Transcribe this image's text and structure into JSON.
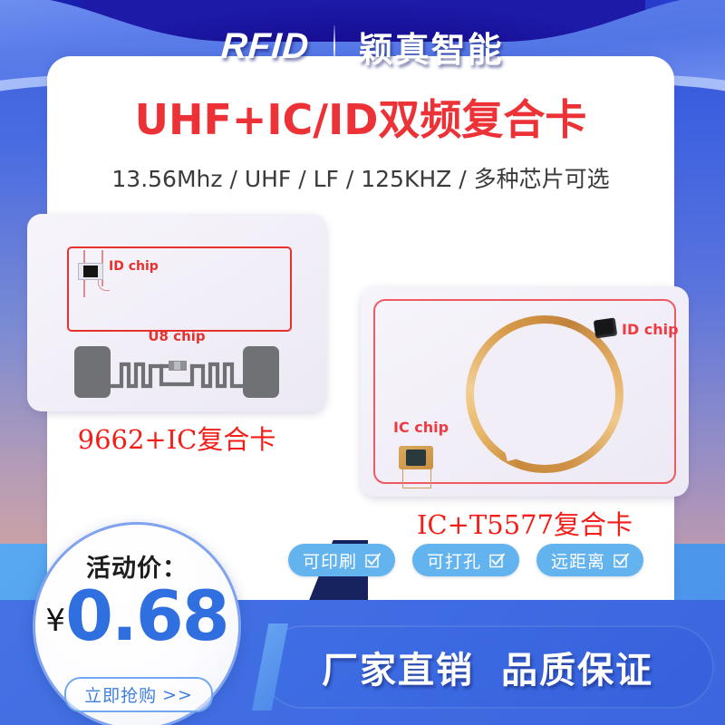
{
  "header": {
    "brand_en": "RFID",
    "brand_cn": "颖真智能",
    "divider": "vertical-divider"
  },
  "title": {
    "main": "UHF+IC/ID双频复合卡",
    "sub": "13.56Mhz / UHF / LF / 125KHZ / 多种芯片可选",
    "main_color": "#ec3237",
    "sub_color": "#3b3b3b"
  },
  "products": [
    {
      "label": "9662+IC复合卡",
      "chip_label": "ID chip",
      "antenna_label": "U8 chip",
      "label_color": "#f31e18"
    },
    {
      "label": "IC+T5577复合卡",
      "id_chip_label": "ID chip",
      "ic_chip_label": "IC chip",
      "label_color": "#f31e18"
    }
  ],
  "badges": [
    {
      "text": "可印刷",
      "icon": "checkbox-checked-icon"
    },
    {
      "text": "可打孔",
      "icon": "checkbox-checked-icon"
    },
    {
      "text": "远距离",
      "icon": "checkbox-checked-icon"
    }
  ],
  "price": {
    "label": "活动价：",
    "currency": "¥",
    "value": "0.68",
    "cta": "立即抢购",
    "cta_arrow": ">>",
    "value_color": "#2f6fe0"
  },
  "slogan": {
    "left": "厂家直销",
    "right": "品质保证"
  },
  "theme": {
    "blue": "#3f6ee4",
    "light_blue": "#63b3ef",
    "navy": "#16235f",
    "red": "#ec3237",
    "white": "#ffffff"
  }
}
